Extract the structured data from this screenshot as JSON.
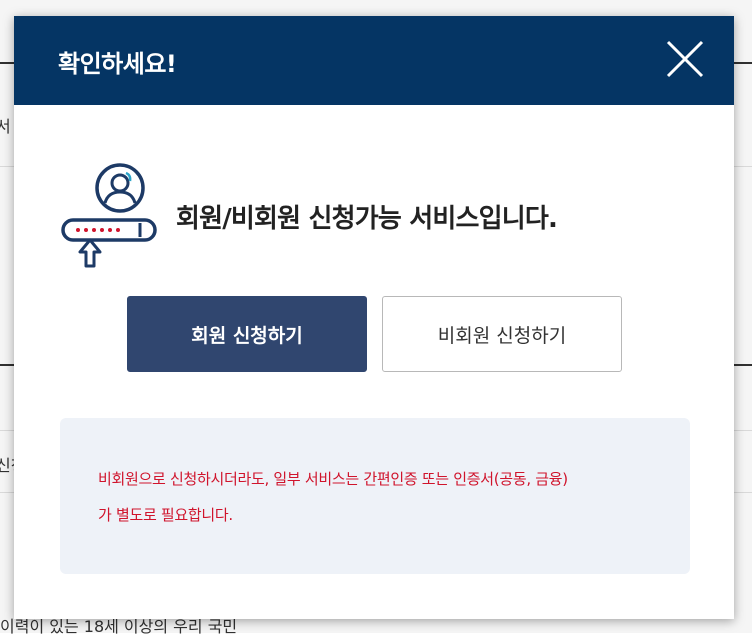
{
  "background": {
    "left_fragments": [
      "서 신",
      "신청"
    ],
    "bottom_text": "이력이 있는 18세 이상의 우리 국민"
  },
  "modal": {
    "title": "확인하세요!",
    "close_icon": "close-icon",
    "service_icon": "user-login-icon",
    "service_message": "회원/비회원 신청가능 서비스입니다.",
    "buttons": {
      "member": "회원 신청하기",
      "guest": "비회원 신청하기"
    },
    "notice": {
      "line1": "비회원으로 신청하시더라도, 일부 서비스는 간편인증 또는 인증서(공동, 금융)",
      "line2": "가 별도로 필요합니다."
    }
  },
  "colors": {
    "header": "#053564",
    "member_button": "#30466f",
    "notice_text": "#d0142c",
    "notice_bg": "#eef2f8"
  }
}
